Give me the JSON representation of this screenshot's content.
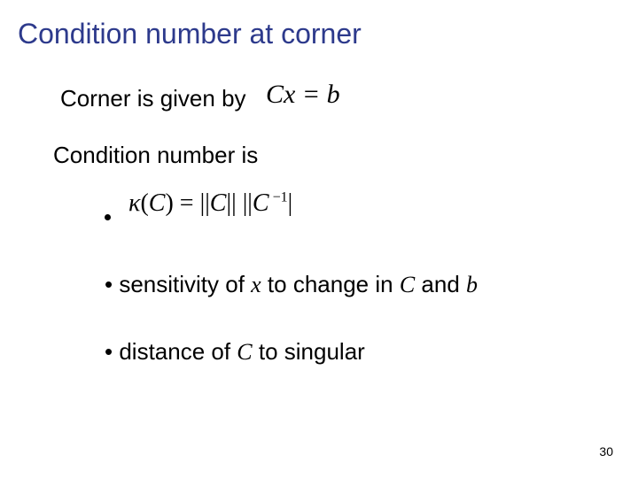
{
  "title": "Condition number at corner",
  "line1": "Corner is given by",
  "eq1_html": "<span style='font-style:italic'>Cx</span> = <span style='font-style:italic'>b</span>",
  "line2": "Condition number is",
  "eq2_html": "<span class='italic'>κ</span>(<span class='italic'>C</span>) = ||<span class='italic'>C</span>|| ||<span class='italic'>C</span><sup>&nbsp;−1</sup>|",
  "bullet2_prefix": "•  sensitivity of ",
  "bullet2_var1": "x",
  "bullet2_mid": " to change in ",
  "bullet2_var2": "C",
  "bullet2_and": " and ",
  "bullet2_var3": "b",
  "bullet3_prefix": "•  distance of ",
  "bullet3_var": "C",
  "bullet3_suffix": " to singular",
  "pagenum": "30"
}
